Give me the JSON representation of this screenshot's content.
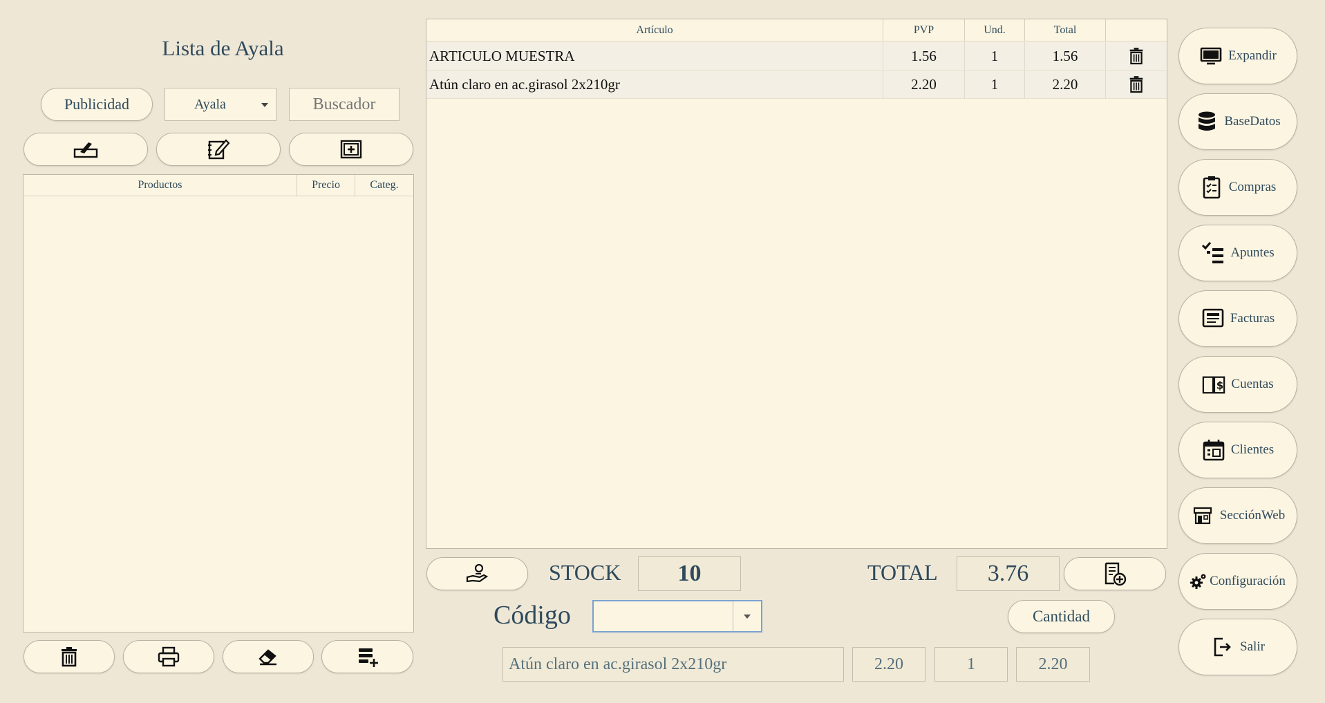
{
  "list": {
    "title": "Lista de Ayala",
    "publicity_label": "Publicidad",
    "list_select_value": "Ayala",
    "search_placeholder": "Buscador",
    "columns": [
      "Productos",
      "Precio",
      "Categ."
    ]
  },
  "icons": {
    "list_tools": [
      "edit-pen-icon",
      "edit-note-icon",
      "add-box-icon"
    ],
    "bottom_tools": [
      "trash-icon",
      "print-icon",
      "eraser-icon",
      "add-list-icon"
    ],
    "stock_button": "hand-coin-icon",
    "add_invoice_button": "invoice-add-icon"
  },
  "ticket": {
    "columns": [
      "Artículo",
      "PVP",
      "Und.",
      "Total"
    ],
    "rows": [
      {
        "articulo": "ARTICULO MUESTRA",
        "pvp": "1.56",
        "und": "1",
        "total": "1.56"
      },
      {
        "articulo": "Atún claro en ac.girasol 2x210gr",
        "pvp": "2.20",
        "und": "1",
        "total": "2.20"
      }
    ]
  },
  "stock": {
    "label": "STOCK",
    "value": "10"
  },
  "total": {
    "label": "TOTAL",
    "value": "3.76"
  },
  "codigo": {
    "label": "Código",
    "value": ""
  },
  "cantidad_label": "Cantidad",
  "selected_item": {
    "name": "Atún claro en ac.girasol 2x210gr",
    "price": "2.20",
    "qty": "1",
    "total": "2.20"
  },
  "menu": [
    {
      "label": "Expandir",
      "icon": "monitor-icon"
    },
    {
      "label": "BaseDatos",
      "icon": "database-icon"
    },
    {
      "label": "Compras",
      "icon": "clipboard-icon"
    },
    {
      "label": "Apuntes",
      "icon": "checklist-icon"
    },
    {
      "label": "Facturas",
      "icon": "receipt-icon"
    },
    {
      "label": "Cuentas",
      "icon": "ledger-icon"
    },
    {
      "label": "Clientes",
      "icon": "calendar-icon"
    },
    {
      "label": "SecciónWeb",
      "icon": "store-icon"
    },
    {
      "label": "Configuración",
      "icon": "gears-icon"
    },
    {
      "label": "Salir",
      "icon": "exit-icon"
    }
  ],
  "colors": {
    "background": "#efe7d6",
    "panel": "#fcf5e2",
    "text": "#2e4a5c",
    "focus_border": "#7aa2d0"
  }
}
